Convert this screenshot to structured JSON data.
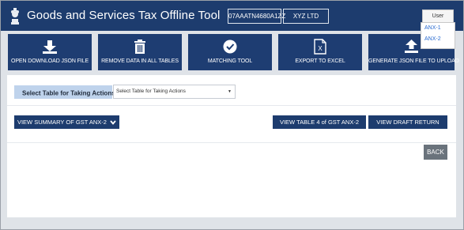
{
  "header": {
    "title": "Goods and Services Tax Offline Tool",
    "gstin": "07AAATN4680A1ZZ",
    "legal_name": "XYZ LTD",
    "colors": {
      "bar": "#1d3c6e"
    }
  },
  "user_manual": {
    "label": "User Manual",
    "items": [
      "ANX-1",
      "ANX-2"
    ]
  },
  "tiles": [
    {
      "label": "OPEN DOWNLOAD JSON FILE",
      "icon": "download-icon"
    },
    {
      "label": "REMOVE DATA IN ALL TABLES",
      "icon": "trash-icon"
    },
    {
      "label": "MATCHING TOOL",
      "icon": "check-circle-icon"
    },
    {
      "label": "EXPORT TO EXCEL",
      "icon": "excel-file-icon"
    },
    {
      "label": "GENERATE JSON FILE TO UPLOAD",
      "icon": "upload-icon"
    }
  ],
  "table_select": {
    "label": "Select Table for Taking Actions",
    "required_mark": "*",
    "value": "Select Table for Taking Actions"
  },
  "buttons": {
    "summary": "VIEW SUMMARY OF GST ANX-2",
    "table4": "VIEW TABLE 4 of GST ANX-2",
    "draft": "VIEW DRAFT RETURN",
    "back": "BACK"
  }
}
